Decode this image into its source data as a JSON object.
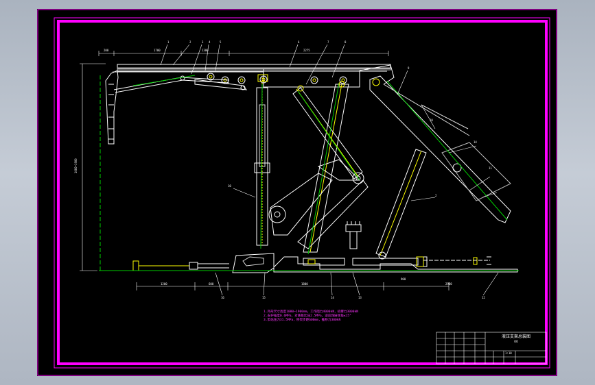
{
  "drawing": {
    "top_dimensions": [
      "200",
      "1700",
      "1300",
      "2275"
    ],
    "part_labels_top": [
      "1",
      "2",
      "3",
      "4",
      "5",
      "6",
      "7",
      "8"
    ],
    "left_height_dimension": "1080~1900",
    "part_labels_right": [
      "9",
      "10",
      "11",
      "14"
    ],
    "part_labels_middle": [
      "10",
      "2"
    ],
    "bottom_dimensions": [
      "1200",
      "600",
      "1800",
      "900",
      "2900"
    ],
    "part_labels_bottom": [
      "16",
      "15",
      "14",
      "13",
      "12"
    ],
    "notes": [
      "1.外形尺寸高度1080~1900mm，工作阻力4000kN，初撑力3000kN",
      "2.支护强度0.6MPa，对底板比压2.5MPa，适应煤层倾角≤15°",
      "3.泵站压力31.5MPa，移架步距600mm，推移力300kN"
    ]
  },
  "title_block": {
    "title": "液压支架总装图",
    "drawing_number": "00",
    "scale": "1:10"
  }
}
